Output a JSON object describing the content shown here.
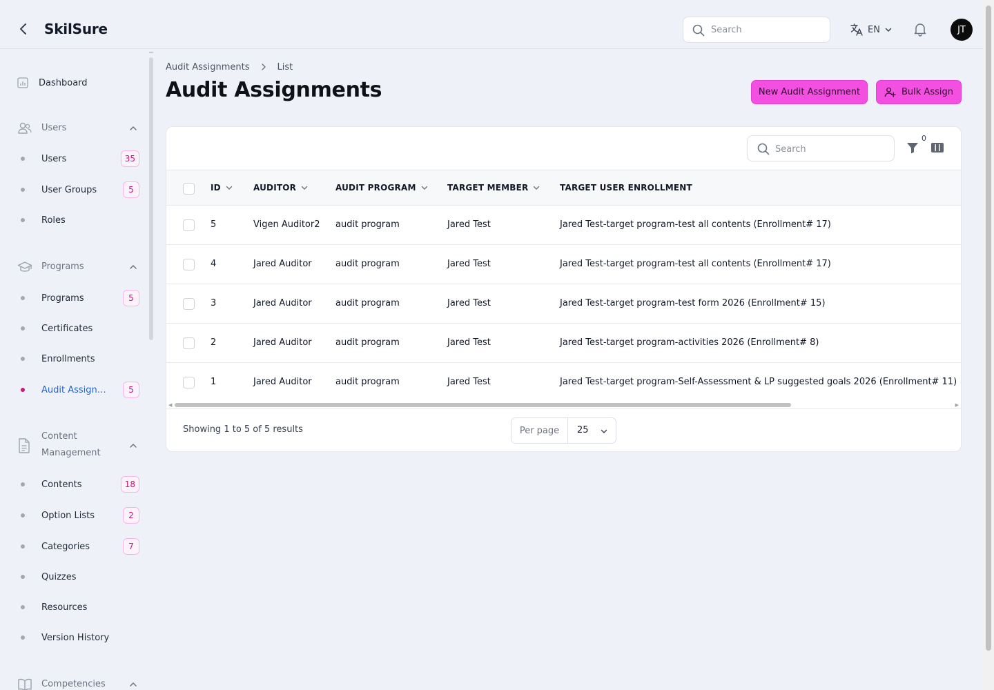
{
  "app": {
    "name": "SkilSure"
  },
  "header": {
    "search_placeholder": "Search",
    "language": "EN",
    "avatar_initials": "JT"
  },
  "sidebar": {
    "dashboard": "Dashboard",
    "users_group": {
      "label": "Users",
      "items": [
        {
          "label": "Users",
          "badge": "35"
        },
        {
          "label": "User Groups",
          "badge": "5"
        },
        {
          "label": "Roles"
        }
      ]
    },
    "programs_group": {
      "label": "Programs",
      "items": [
        {
          "label": "Programs",
          "badge": "5"
        },
        {
          "label": "Certificates"
        },
        {
          "label": "Enrollments"
        },
        {
          "label": "Audit Assignments",
          "badge": "5",
          "active": true
        }
      ]
    },
    "content_group": {
      "label": "Content Management",
      "items": [
        {
          "label": "Contents",
          "badge": "18"
        },
        {
          "label": "Option Lists",
          "badge": "2"
        },
        {
          "label": "Categories",
          "badge": "7"
        },
        {
          "label": "Quizzes"
        },
        {
          "label": "Resources"
        },
        {
          "label": "Version History"
        }
      ]
    },
    "competencies_group": {
      "label": "Competencies"
    }
  },
  "breadcrumb": [
    "Audit Assignments",
    "List"
  ],
  "page": {
    "title": "Audit Assignments",
    "new_button": "New Audit Assignment",
    "bulk_button": "Bulk Assign"
  },
  "table": {
    "search_placeholder": "Search",
    "filter_count": "0",
    "columns": [
      "ID",
      "AUDITOR",
      "AUDIT PROGRAM",
      "TARGET MEMBER",
      "TARGET USER ENROLLMENT"
    ],
    "rows": [
      {
        "id": "5",
        "auditor": "Vigen Auditor2",
        "program": "audit program",
        "member": "Jared Test",
        "enrollment": "Jared Test-target program-test all contents (Enrollment# 17)"
      },
      {
        "id": "4",
        "auditor": "Jared Auditor",
        "program": "audit program",
        "member": "Jared Test",
        "enrollment": "Jared Test-target program-test all contents (Enrollment# 17)"
      },
      {
        "id": "3",
        "auditor": "Jared Auditor",
        "program": "audit program",
        "member": "Jared Test",
        "enrollment": "Jared Test-target program-test form 2026 (Enrollment# 15)"
      },
      {
        "id": "2",
        "auditor": "Jared Auditor",
        "program": "audit program",
        "member": "Jared Test",
        "enrollment": "Jared Test-target program-activities 2026 (Enrollment# 8)"
      },
      {
        "id": "1",
        "auditor": "Jared Auditor",
        "program": "audit program",
        "member": "Jared Test",
        "enrollment": "Jared Test-target program-Self-Assessment & LP suggested goals 2026 (Enrollment# 11)"
      }
    ],
    "showing": "Showing 1 to 5 of 5 results",
    "per_page_label": "Per page",
    "per_page_value": "25"
  },
  "colors": {
    "accent": "#f34fe0",
    "badge_text": "#c0187c",
    "active_link": "#2563c9",
    "background": "#eef2f8"
  },
  "icons": [
    "back-arrow-icon",
    "search-icon",
    "translate-icon",
    "chevron-down-icon",
    "bell-icon",
    "chart-icon",
    "users-icon",
    "graduation-cap-icon",
    "document-icon",
    "book-icon",
    "chevron-up-icon",
    "chevron-right-icon",
    "user-plus-icon",
    "filter-icon",
    "columns-icon"
  ]
}
